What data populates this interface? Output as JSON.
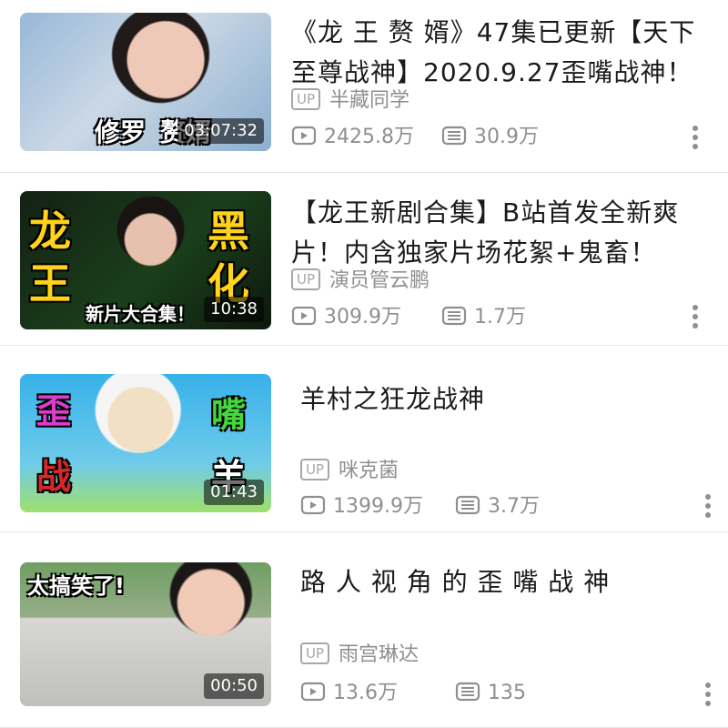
{
  "items": [
    {
      "title": "《龙 王 赘 婿》47集已更新【天下至尊战神】2020.9.27歪嘴战神！",
      "uploader_badge": "UP",
      "uploader": "半藏同学",
      "views": "2425.8万",
      "comments": "30.9万",
      "duration": "03:07:32",
      "thumb_text": [
        "修罗",
        "赘婿"
      ]
    },
    {
      "title": "【龙王新剧合集】B站首发全新爽片！内含独家片场花絮+鬼畜！",
      "uploader_badge": "UP",
      "uploader": "演员管云鹏",
      "views": "309.9万",
      "comments": "1.7万",
      "duration": "10:38",
      "thumb_text": [
        "龙",
        "王",
        "黑",
        "化",
        "新片大合集！"
      ]
    },
    {
      "title": "羊村之狂龙战神",
      "uploader_badge": "UP",
      "uploader": "咪克菌",
      "views": "1399.9万",
      "comments": "3.7万",
      "duration": "01:43",
      "thumb_text": [
        "歪",
        "战",
        "嘴",
        "羊"
      ]
    },
    {
      "title": "路 人 视 角 的 歪 嘴 战 神",
      "uploader_badge": "UP",
      "uploader": "雨宫琳达",
      "views": "13.6万",
      "comments": "135",
      "duration": "00:50",
      "thumb_text": [
        "太搞笑了!"
      ]
    }
  ],
  "icons": {
    "play": "play-count-icon",
    "comment": "comment-count-icon",
    "more": "more-options-icon"
  },
  "colors": {
    "title": "#1b1b1b",
    "meta": "#8f8f8f",
    "divider": "#e7e7e7"
  }
}
